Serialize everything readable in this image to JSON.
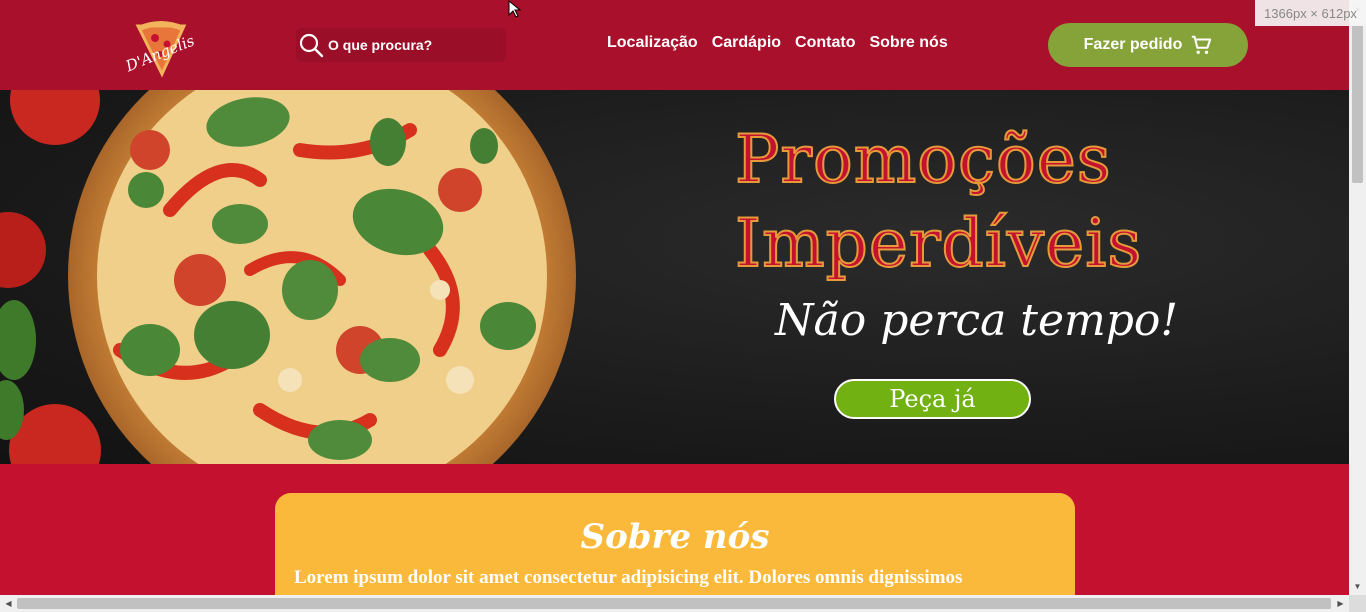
{
  "header": {
    "logo_text": "D'Angelis",
    "search_placeholder": "O que procura?",
    "nav": [
      "Localização",
      "Cardápio",
      "Contato",
      "Sobre nós"
    ],
    "order_button": "Fazer pedido"
  },
  "hero": {
    "title": "Promoções Imperdíveis",
    "subtitle": "Não perca tempo!",
    "cta": "Peça já"
  },
  "about": {
    "title": "Sobre nós",
    "text": "Lorem ipsum dolor sit amet consectetur adipisicing elit. Dolores omnis dignissimos"
  },
  "overlay": {
    "size_tooltip": "1366px × 612px"
  },
  "colors": {
    "brand_red": "#a8102c",
    "page_red": "#c4112f",
    "green_button": "#86a33a",
    "cta_green": "#71b112",
    "card_yellow": "#fbb93b"
  }
}
